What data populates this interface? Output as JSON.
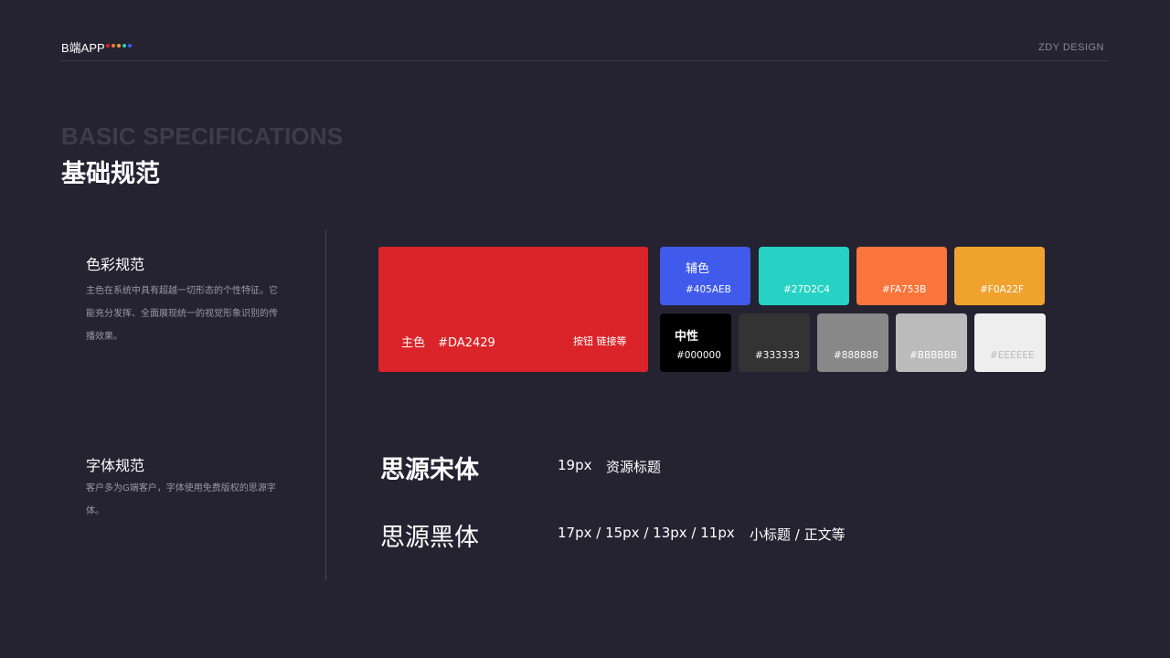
{
  "header": {
    "brand": "B端APP",
    "dot_colors": [
      "#DA2429",
      "#FA753B",
      "#F0A22F",
      "#27D2C4",
      "#405AEB"
    ],
    "design_label": "ZDY DESIGN"
  },
  "title": {
    "background_text": "BASIC SPECIFICATIONS",
    "main_text": "基础规范"
  },
  "color_section": {
    "heading": "色彩规范",
    "description": "主色在系统中具有超越一切形态的个性特征。它能充分发挥、全面展现统一的视觉形象识别的传播效果。",
    "primary": {
      "label": "主色",
      "hex": "#DA2429",
      "note": "按钮 链接等"
    },
    "secondary": {
      "label": "辅色",
      "swatches": [
        {
          "hex": "#405AEB",
          "color": "#405AEB"
        },
        {
          "hex": "#27D2C4",
          "color": "#27D2C4"
        },
        {
          "hex": "#FA753B",
          "color": "#FA753B"
        },
        {
          "hex": "#F0A22F",
          "color": "#F0A22F"
        }
      ]
    },
    "neutral": {
      "label": "中性",
      "swatches": [
        {
          "hex": "#000000",
          "color": "#000000",
          "text_color": "#ffffff"
        },
        {
          "hex": "#333333",
          "color": "#333333",
          "text_color": "#ffffff"
        },
        {
          "hex": "#888888",
          "color": "#888888",
          "text_color": "#ffffff"
        },
        {
          "hex": "#BBBBBB",
          "color": "#BBBBBB",
          "text_color": "#ffffff"
        },
        {
          "hex": "#EEEEEE",
          "color": "#EEEEEE",
          "text_color": "#bbbbbb"
        }
      ]
    }
  },
  "font_section": {
    "heading": "字体规范",
    "description": "客户多为G端客户，字体使用免费版权的思源字体。",
    "fonts": [
      {
        "name": "思源宋体",
        "sizes": "19px",
        "usage": "资源标题"
      },
      {
        "name": "思源黑体",
        "sizes": "17px / 15px / 13px / 11px",
        "usage": "小标题 / 正文等"
      }
    ]
  }
}
